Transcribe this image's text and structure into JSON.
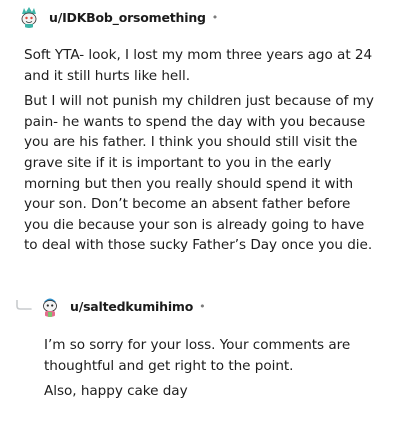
{
  "comment1": {
    "username": "u/IDKBob_orsomething",
    "separator": "•",
    "avatar": "snoo-avatar-icon",
    "paragraphs": [
      "Soft YTA- look, I lost my mom three years ago at 24 and it still hurts like hell.",
      "But I will not punish my children just because of my pain- he wants to spend the day with you because you are his father. I think you should still visit the grave site if it is important to you in the early morning but then you really should spend it with your son. Don’t become an absent father before you die because your son is already going to have to deal with those sucky Father’s Day once you die."
    ]
  },
  "comment2": {
    "username": "u/saltedkumihimo",
    "separator": "•",
    "avatar": "snoo-avatar-icon",
    "reply_icon": "reply-arrow-icon",
    "paragraphs": [
      "I’m so sorry for your loss. Your comments are thoughtful and get right to the point.",
      "Also, happy cake day"
    ]
  },
  "colors": {
    "text": "#1c1c1c",
    "meta": "#7c7c7c",
    "thread_line": "#c8cbcd"
  }
}
